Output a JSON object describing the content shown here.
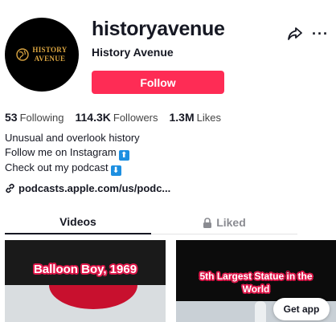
{
  "profile": {
    "username": "historyavenue",
    "nickname": "History Avenue",
    "follow_label": "Follow",
    "avatar_logo": {
      "line1": "HISTORY",
      "line2": "AVENUE"
    }
  },
  "actions": {
    "share_icon": "share-icon",
    "more_label": "···"
  },
  "stats": {
    "following": {
      "value": "53",
      "label": "Following"
    },
    "followers": {
      "value": "114.3K",
      "label": "Followers"
    },
    "likes": {
      "value": "1.3M",
      "label": "Likes"
    }
  },
  "bio": {
    "line1": "Unusual and overlook history",
    "line2": "Follow me on Instagram",
    "line2_emoji": "⬆",
    "line3": "Check out my podcast",
    "line3_emoji": "⬇"
  },
  "link": {
    "text": "podcasts.apple.com/us/podc...",
    "icon": "link-icon"
  },
  "tabs": {
    "videos": "Videos",
    "liked": "Liked"
  },
  "videos": [
    {
      "caption": "Balloon Boy, 1969"
    },
    {
      "caption_line1": "5th Largest Statue in the",
      "caption_line2": "World"
    }
  ],
  "get_app": "Get app",
  "colors": {
    "accent": "#fe2c55",
    "text": "#161823",
    "muted": "#8a8b91",
    "gold": "#d9a441"
  }
}
